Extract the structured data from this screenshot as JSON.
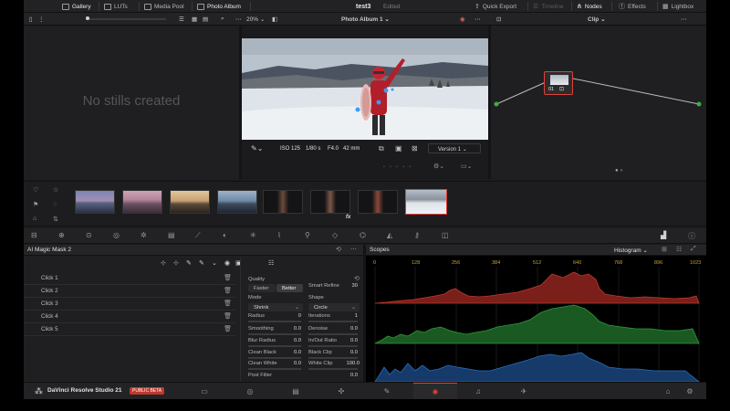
{
  "titlebar": {
    "project_name": "test3",
    "status": "Edited",
    "gallery": "Gallery",
    "luts": "LUTs",
    "media_pool": "Media Pool",
    "photo_album": "Photo Album",
    "quick_export": "Quick Export",
    "timeline": "Timeline",
    "nodes": "Nodes",
    "effects": "Effects",
    "lightbox": "Lightbox"
  },
  "viewer_bar": {
    "zoom": "20%",
    "album_select": "Photo Album 1",
    "clip_select": "Clip"
  },
  "gallery": {
    "empty_message": "No stills created"
  },
  "viewer_info": {
    "iso": "ISO 125",
    "shutter": "1/80 s",
    "aperture": "F4.0",
    "focal": "42 mm",
    "version": "Version 1"
  },
  "node": {
    "label": "01",
    "sub": "‹̲₲̵"
  },
  "thumbnail_strip": {
    "fx_label": "fx",
    "selected_index": 7
  },
  "magic_mask": {
    "title": "AI Magic Mask 2",
    "clicks": [
      "Click 1",
      "Click 2",
      "Click 3",
      "Click 4",
      "Click 5"
    ],
    "quality_label": "Quality",
    "faster": "Faster",
    "better": "Better",
    "smart_refine_label": "Smart Refine",
    "smart_refine_value": "30",
    "mode_label": "Mode",
    "mode_value": "Shrink",
    "shape_label": "Shape",
    "shape_value": "Circle",
    "radius_label": "Radius",
    "radius_value": "0",
    "iterations_label": "Iterations",
    "iterations_value": "1",
    "smoothing_label": "Smoothing",
    "smoothing_value": "0.0",
    "denoise_label": "Denoise",
    "denoise_value": "0.0",
    "blur_radius_label": "Blur Radius",
    "blur_radius_value": "0.0",
    "inout_ratio_label": "In/Out Ratio",
    "inout_ratio_value": "0.0",
    "clean_black_label": "Clean Black",
    "clean_black_value": "0.0",
    "black_clip_label": "Black Clip",
    "black_clip_value": "0.0",
    "clean_white_label": "Clean White",
    "clean_white_value": "0.0",
    "white_clip_label": "White Clip",
    "white_clip_value": "100.0",
    "post_filter_label": "Post Filter",
    "post_filter_value": "0.0"
  },
  "scopes": {
    "title": "Scopes",
    "mode": "Histogram",
    "ticks": [
      "0",
      "128",
      "256",
      "384",
      "512",
      "640",
      "768",
      "896",
      "1023"
    ]
  },
  "bottom": {
    "app_name": "DaVinci Resolve Studio 21",
    "badge": "PUBLIC BETA"
  },
  "colors": {
    "accent_red": "#e0403a",
    "tick_gold": "#c8a23a",
    "hist_red": "#c0392b",
    "hist_green": "#2e9a3a",
    "hist_blue": "#2a6fbf"
  }
}
